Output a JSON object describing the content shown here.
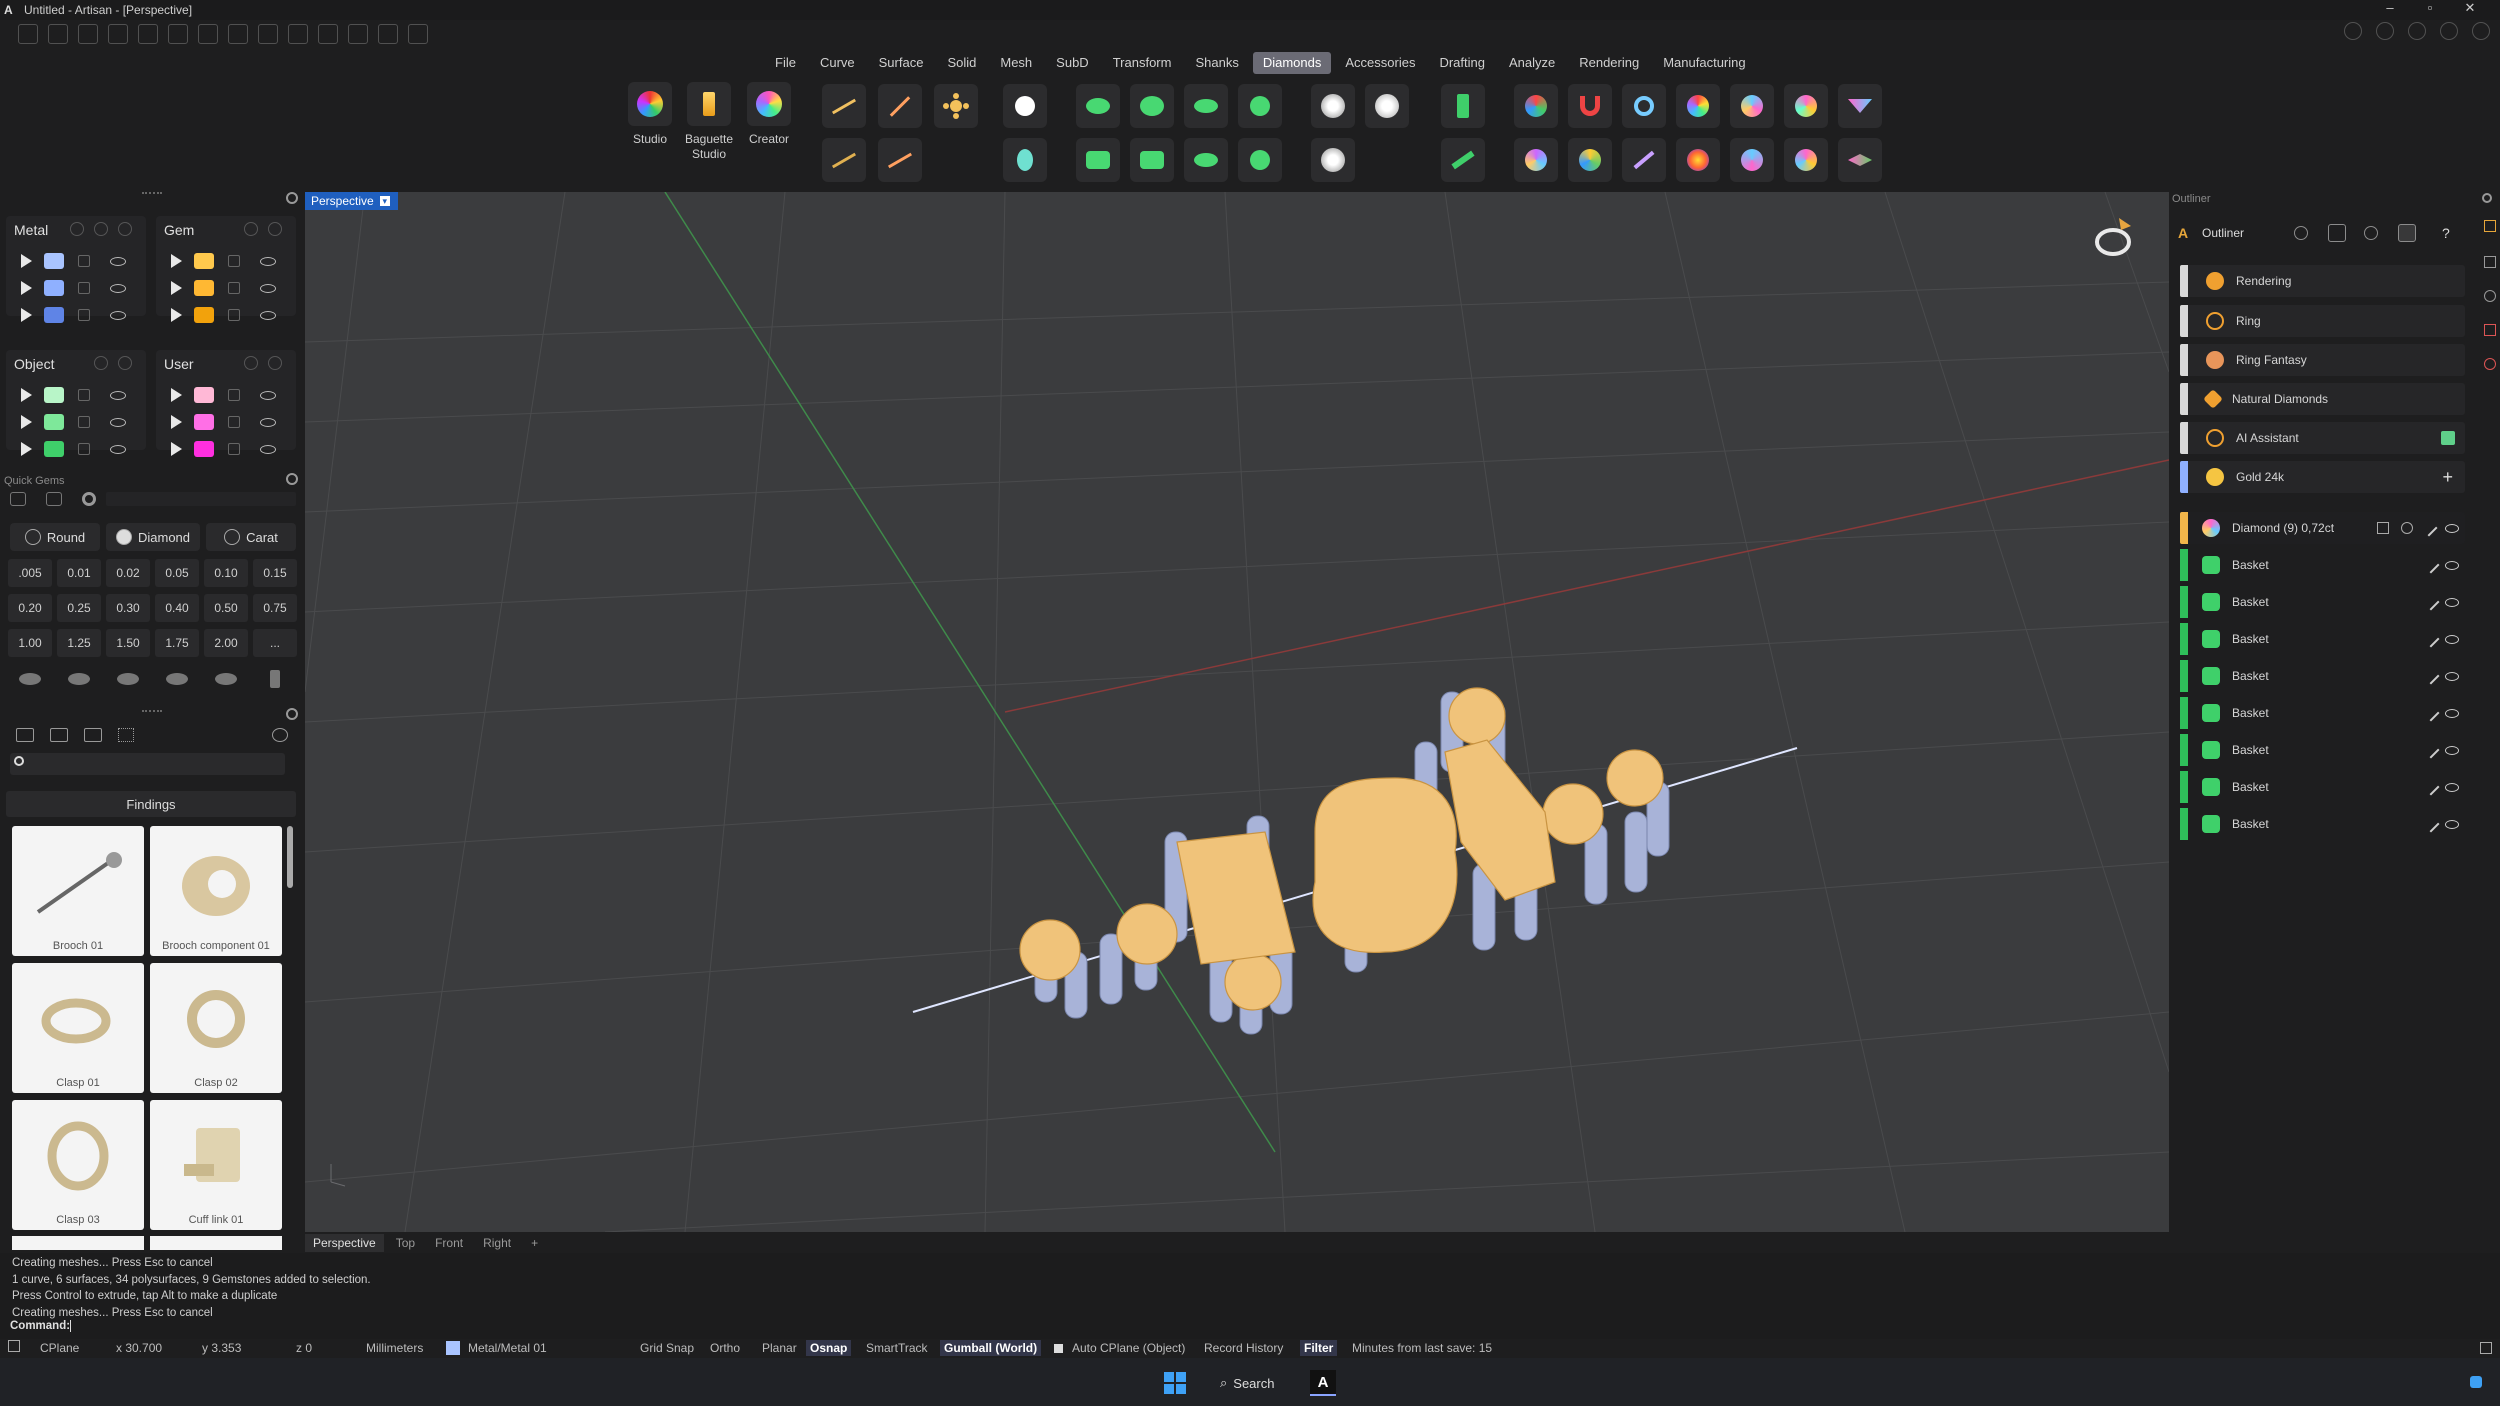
{
  "window": {
    "title": "Untitled - Artisan - [Perspective]",
    "logo": "A",
    "controls": [
      "minimize-icon",
      "maximize-icon",
      "close-icon"
    ]
  },
  "menu": {
    "items": [
      "File",
      "Curve",
      "Surface",
      "Solid",
      "Mesh",
      "SubD",
      "Transform",
      "Shanks",
      "Diamonds",
      "Accessories",
      "Drafting",
      "Analyze",
      "Rendering",
      "Manufacturing"
    ],
    "active": "Diamonds"
  },
  "ribbon": {
    "studio": "Studio",
    "baguette_studio_1": "Baguette",
    "baguette_studio_2": "Studio",
    "creator": "Creator"
  },
  "layers": {
    "metal": {
      "title": "Metal",
      "colors": [
        "#a9c4ff",
        "#8fb0ff",
        "#5f84e6"
      ]
    },
    "gem": {
      "title": "Gem",
      "colors": [
        "#ffc94d",
        "#ffb833",
        "#f2a20c"
      ]
    },
    "object": {
      "title": "Object",
      "colors": [
        "#b8f5c8",
        "#7ee89a",
        "#3fcf6a"
      ]
    },
    "user": {
      "title": "User",
      "colors": [
        "#ffb8d6",
        "#ff6fe6",
        "#ff2fe0"
      ]
    }
  },
  "quick_gems": {
    "label": "Quick Gems",
    "shape": "Round",
    "type": "Diamond",
    "unit": "Carat",
    "carats": [
      ".005",
      "0.01",
      "0.02",
      "0.05",
      "0.10",
      "0.15",
      "0.20",
      "0.25",
      "0.30",
      "0.40",
      "0.50",
      "0.75",
      "1.00",
      "1.25",
      "1.50",
      "1.75",
      "2.00",
      "..."
    ]
  },
  "library": {
    "category": "Findings",
    "items": [
      "Brooch 01",
      "Brooch component 01",
      "Clasp 01",
      "Clasp 02",
      "Clasp 03",
      "Cuff link 01"
    ]
  },
  "viewport": {
    "active_view": "Perspective",
    "tabs": [
      "Perspective",
      "Top",
      "Front",
      "Right"
    ],
    "add_tab": "+"
  },
  "outliner": {
    "panel_label": "Outliner",
    "title": "Outliner",
    "categories": [
      {
        "label": "Rendering",
        "icon": "rendering-icon"
      },
      {
        "label": "Ring",
        "icon": "ring-icon"
      },
      {
        "label": "Ring Fantasy",
        "icon": "ring-fantasy-icon"
      },
      {
        "label": "Natural Diamonds",
        "icon": "natural-diamond-icon"
      },
      {
        "label": "AI Assistant",
        "icon": "ai-assistant-icon"
      },
      {
        "label": "Gold 24k",
        "icon": "gold-icon"
      }
    ],
    "add_label": "+",
    "group": {
      "label": "Diamond (9) 0,72ct"
    },
    "objects": [
      "Basket",
      "Basket",
      "Basket",
      "Basket",
      "Basket",
      "Basket",
      "Basket",
      "Basket"
    ]
  },
  "command": {
    "log": [
      "Creating meshes... Press Esc to cancel",
      "1 curve, 6 surfaces, 34 polysurfaces, 9 Gemstones added to selection.",
      "Press Control to extrude, tap Alt to make a duplicate",
      "Creating meshes... Press Esc to cancel"
    ],
    "prompt": "Command:"
  },
  "status": {
    "cplane": "CPlane",
    "x": "x 30.700",
    "y": "y 3.353",
    "z": "z 0",
    "units": "Millimeters",
    "layer": "Metal/Metal 01",
    "grid_snap": "Grid Snap",
    "ortho": "Ortho",
    "planar": "Planar",
    "osnap": "Osnap",
    "smarttrack": "SmartTrack",
    "gumball": "Gumball (World)",
    "auto_cplane": "Auto CPlane (Object)",
    "record_history": "Record History",
    "filter": "Filter",
    "last_save": "Minutes from last save: 15"
  },
  "taskbar": {
    "search": "Search"
  }
}
